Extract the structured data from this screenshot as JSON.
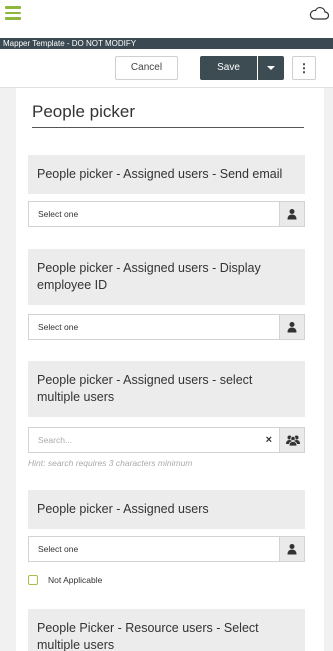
{
  "app": {
    "template_name": "Mapper Template - DO NOT MODIFY"
  },
  "toolbar": {
    "cancel_label": "Cancel",
    "save_label": "Save",
    "more_label": "⋮"
  },
  "form": {
    "section_title": "People picker",
    "fields": [
      {
        "label": "People picker - Assigned users - Send email",
        "value": "Select one"
      },
      {
        "label": "People picker - Assigned users - Display employee ID",
        "value": "Select one"
      },
      {
        "label": "People picker - Assigned users - select multiple users",
        "placeholder": "Search...",
        "clear": "×",
        "hint": "Hint: search requires 3 characters minimum"
      },
      {
        "label": "People picker - Assigned users",
        "value": "Select one",
        "checkbox_label": "Not Applicable"
      },
      {
        "label": "People Picker - Resource users - Select multiple users"
      }
    ]
  },
  "icons": {
    "menu": "hamburger-icon",
    "cloud": "cloud-icon",
    "dropdown": "caret-down-icon",
    "person": "person-icon",
    "people": "people-icon"
  },
  "colors": {
    "accent_green": "#8db63c",
    "dark": "#3d4b53",
    "label_bg": "#ececec"
  }
}
